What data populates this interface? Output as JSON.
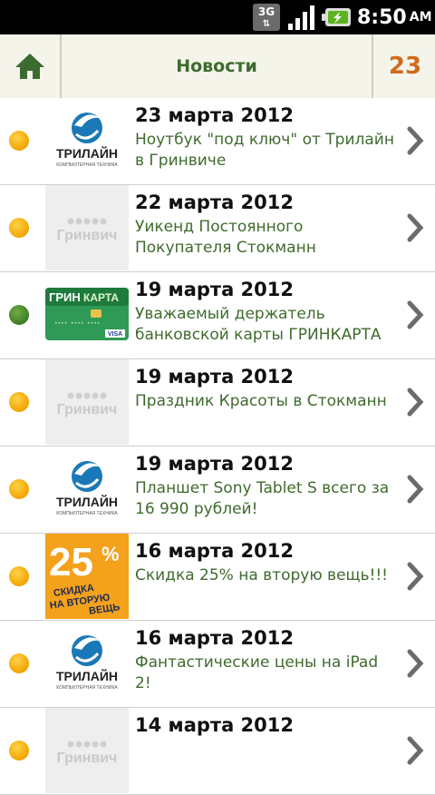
{
  "status_bar": {
    "network": "3G",
    "time": "8:50",
    "ampm": "AM",
    "icons": [
      "network-3g-icon",
      "signal-icon",
      "battery-charging-icon"
    ]
  },
  "header": {
    "home_icon": "home-icon",
    "title": "Новости",
    "count": "23"
  },
  "logo_texts": {
    "trilain": "ТРИЛАЙН",
    "trilain_sub": "КОМПЬЮТЕРНАЯ ТЕХНИКА",
    "grinvich": "Гринвич",
    "grinkarta_a": "ГРИН",
    "grinkarta_b": "КАРТА",
    "visa": "VISA",
    "discount_num": "25",
    "discount_pct": "%",
    "discount_l1": "СКИДКА",
    "discount_l2": "НА ВТОРУЮ",
    "discount_l3": "ВЕЩЬ"
  },
  "news": [
    {
      "date": "23 марта 2012",
      "text": "Ноутбук \"под ключ\" от Трилайн в Гринвиче",
      "status": "orange",
      "logo": "trilain"
    },
    {
      "date": "22 марта 2012",
      "text": "Уикенд Постоянного Покупателя Стокманн",
      "status": "orange",
      "logo": "grinvich"
    },
    {
      "date": "19 марта 2012",
      "text": "Уважаемый держатель банковской карты ГРИНКАРТА",
      "status": "green",
      "logo": "grinkarta"
    },
    {
      "date": "19 марта 2012",
      "text": "Праздник Красоты в Стокманн",
      "status": "orange",
      "logo": "grinvich"
    },
    {
      "date": "19 марта 2012",
      "text": "Планшет Sony Tablet S всего за 16 990 рублей!",
      "status": "orange",
      "logo": "trilain"
    },
    {
      "date": "16 марта 2012",
      "text": "Скидка 25% на вторую вещь!!!",
      "status": "orange",
      "logo": "discount"
    },
    {
      "date": "16 марта 2012",
      "text": "Фантастические цены на iPad 2!",
      "status": "orange",
      "logo": "trilain"
    },
    {
      "date": "14 марта 2012",
      "text": "",
      "status": "orange",
      "logo": "grinvich"
    }
  ]
}
